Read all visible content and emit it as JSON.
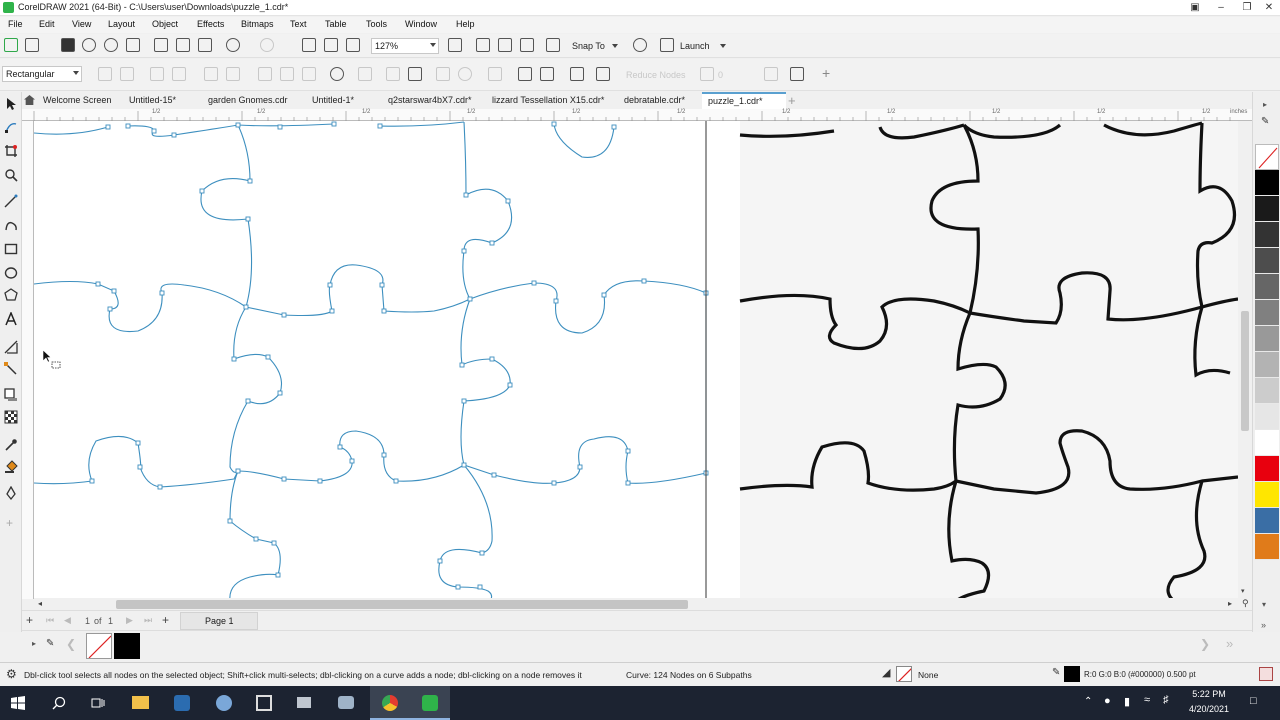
{
  "window": {
    "title": "CorelDRAW 2021 (64-Bit) - C:\\Users\\user\\Downloads\\puzzle_1.cdr*",
    "minimize": "–",
    "restore": "❐",
    "close": "✕"
  },
  "menu": [
    "File",
    "Edit",
    "View",
    "Layout",
    "Object",
    "Effects",
    "Bitmaps",
    "Text",
    "Table",
    "Tools",
    "Window",
    "Help"
  ],
  "toolbar": {
    "zoom": "127%",
    "snap_to": "Snap To",
    "launch": "Launch"
  },
  "property_bar": {
    "selection_mode": "Rectangular",
    "reduce_nodes": "Reduce Nodes",
    "smoothness": "0"
  },
  "tabs": [
    "Welcome Screen",
    "Untitled-15*",
    "garden Gnomes.cdr",
    "Untitled-1*",
    "q2starswar4bX7.cdr*",
    "lizzard Tessellation X15.cdr*",
    "debratable.cdr*",
    "puzzle_1.cdr*"
  ],
  "active_tab": "puzzle_1.cdr*",
  "ruler_units": "inches",
  "ruler_labels": [
    "1/2",
    "1/2",
    "1/2",
    "1/2",
    "1/2",
    "1/2",
    "1/2",
    "1/2",
    "1/2",
    "1/2",
    "1/2",
    "1/2"
  ],
  "page_nav": {
    "current": "1",
    "of_label": "of",
    "total": "1",
    "page_tab": "Page 1"
  },
  "status": {
    "hint": "Dbl-click tool selects all nodes on the selected object; Shift+click multi-selects; dbl-clicking on a curve adds a node; dbl-clicking on a node removes it",
    "curve_info": "Curve: 124 Nodes on 6 Subpaths",
    "fill": "None",
    "outline": "R:0 G:0 B:0 (#000000)  0.500 pt"
  },
  "taskbar": {
    "time": "5:22 PM",
    "date": "4/20/2021"
  },
  "palette_colors": [
    "#ffffff",
    "#000000",
    "#1a1a1a",
    "#333333",
    "#4d4d4d",
    "#666666",
    "#808080",
    "#999999",
    "#b3b3b3",
    "#cccccc",
    "#e6e6e6",
    "#ffffff",
    "#e8000e",
    "#ffe600",
    "#3a6ea5",
    "#e07b1a"
  ],
  "colors": {
    "accent": "#5aa0d0",
    "curve": "#3d8fbf",
    "taskbar": "#1c2331"
  }
}
